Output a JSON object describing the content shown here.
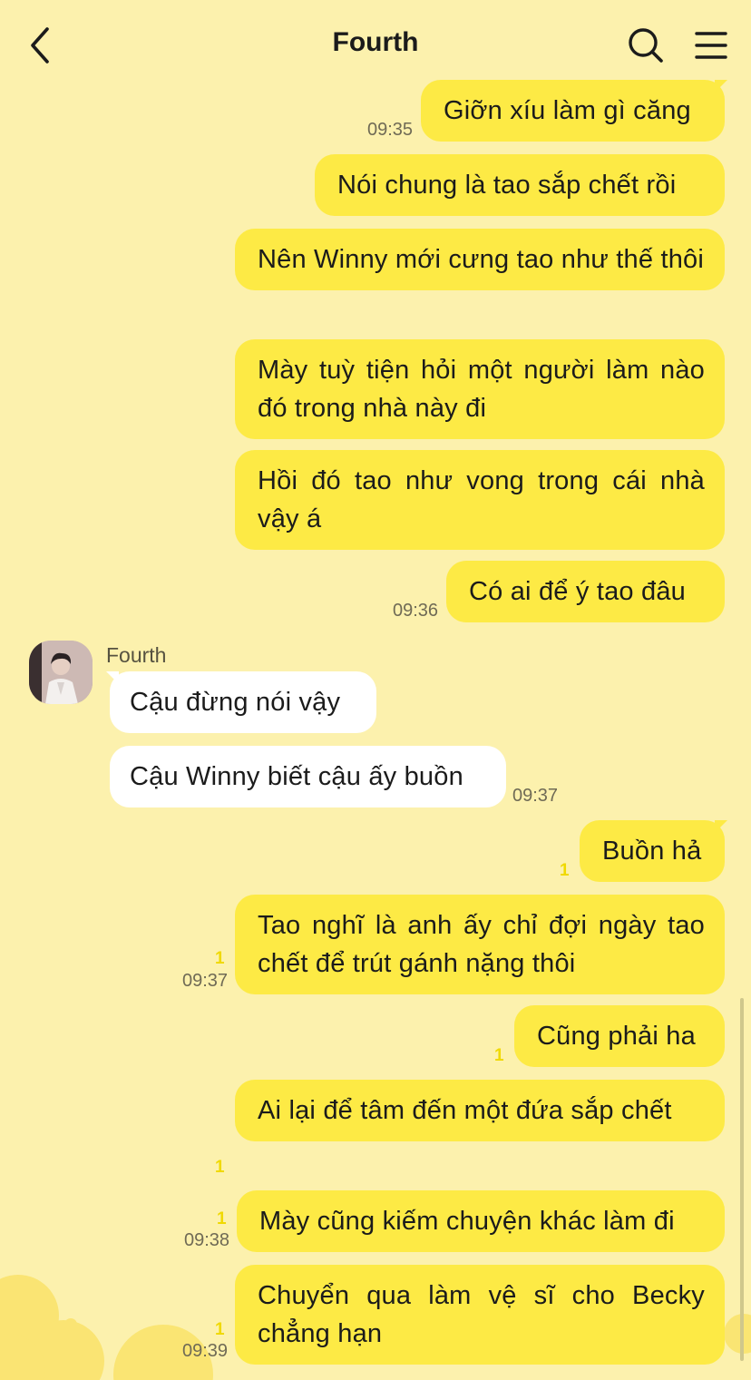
{
  "header": {
    "title": "Fourth",
    "back_icon": "chevron-left-icon",
    "search_icon": "search-icon",
    "menu_icon": "hamburger-menu-icon"
  },
  "colors": {
    "background": "#fcf1ad",
    "my_bubble": "#fdea45",
    "their_bubble": "#ffffff",
    "unread": "#f0d900"
  },
  "contact": {
    "name": "Fourth",
    "avatar": "profile-photo-man-in-white-suit"
  },
  "messages": [
    {
      "from": "me",
      "text": "Giỡn xíu làm gì căng",
      "time": "09:35"
    },
    {
      "from": "me",
      "text": "Nói chung là tao sắp chết rồi"
    },
    {
      "from": "me",
      "text": "Nên Winny mới cưng tao như thế thôi"
    },
    {
      "from": "me",
      "text": "Mày tuỳ tiện hỏi một người làm nào đó trong nhà này đi"
    },
    {
      "from": "me",
      "text": "Hồi đó tao như vong trong cái nhà vậy á"
    },
    {
      "from": "me",
      "text": "Có ai để ý tao đâu",
      "time": "09:36"
    },
    {
      "from": "them",
      "text": "Cậu đừng nói vậy"
    },
    {
      "from": "them",
      "text": "Cậu Winny biết cậu ấy buồn",
      "time": "09:37"
    },
    {
      "from": "me",
      "text": "Buồn hả",
      "unread": "1"
    },
    {
      "from": "me",
      "text": "Tao nghĩ là anh ấy chỉ đợi ngày tao chết để trút gánh nặng thôi",
      "unread": "1",
      "time": "09:37"
    },
    {
      "from": "me",
      "text": "Cũng phải ha",
      "unread": "1"
    },
    {
      "from": "me",
      "text": "Ai lại để tâm đến một đứa sắp chết",
      "unread": "1"
    },
    {
      "from": "me",
      "text": "Mày cũng kiếm chuyện khác làm đi",
      "unread": "1",
      "time": "09:38"
    },
    {
      "from": "me",
      "text": "Chuyển qua làm vệ sĩ cho Becky chẳng hạn",
      "unread": "1",
      "time": "09:39"
    }
  ]
}
